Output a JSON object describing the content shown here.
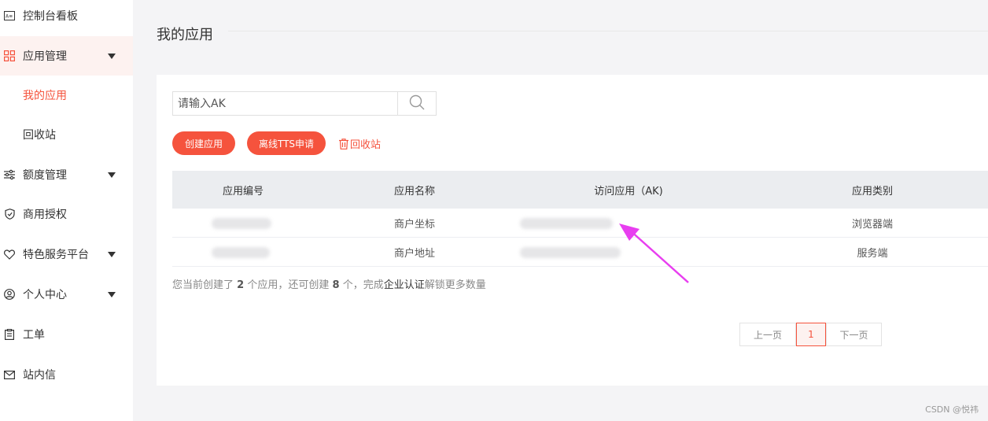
{
  "sidebar": {
    "items": [
      {
        "label": "控制台看板",
        "icon": "dashboard-icon"
      },
      {
        "label": "应用管理",
        "icon": "apps-grid-icon"
      },
      {
        "label": "我的应用"
      },
      {
        "label": "回收站"
      },
      {
        "label": "额度管理",
        "icon": "sliders-icon"
      },
      {
        "label": "商用授权",
        "icon": "shield-check-icon"
      },
      {
        "label": "特色服务平台",
        "icon": "heart-icon"
      },
      {
        "label": "个人中心",
        "icon": "user-icon"
      },
      {
        "label": "工单",
        "icon": "clipboard-icon"
      },
      {
        "label": "站内信",
        "icon": "mail-icon"
      }
    ]
  },
  "page": {
    "title": "我的应用"
  },
  "search": {
    "placeholder": "请输入AK",
    "icon": "search-icon"
  },
  "actions": {
    "create": "创建应用",
    "offline_tts": "离线TTS申请",
    "recycle": "回收站",
    "recycle_icon": "trash-icon"
  },
  "table": {
    "headers": [
      "应用编号",
      "应用名称",
      "访问应用（AK)",
      "应用类别"
    ],
    "rows": [
      {
        "name": "商户坐标",
        "category": "浏览器端"
      },
      {
        "name": "商户地址",
        "category": "服务端"
      }
    ]
  },
  "summary": {
    "p1": "您当前创建了",
    "created": "2",
    "p2": "个应用，还可创建",
    "remaining": "8",
    "p3": "个，完成",
    "link": "企业认证",
    "p4": "解锁更多数量"
  },
  "pagination": {
    "prev": "上一页",
    "current": "1",
    "next": "下一页"
  },
  "watermark": "CSDN @悦祎",
  "colors": {
    "accent": "#f5533d",
    "arrow": "#e83ef0"
  }
}
